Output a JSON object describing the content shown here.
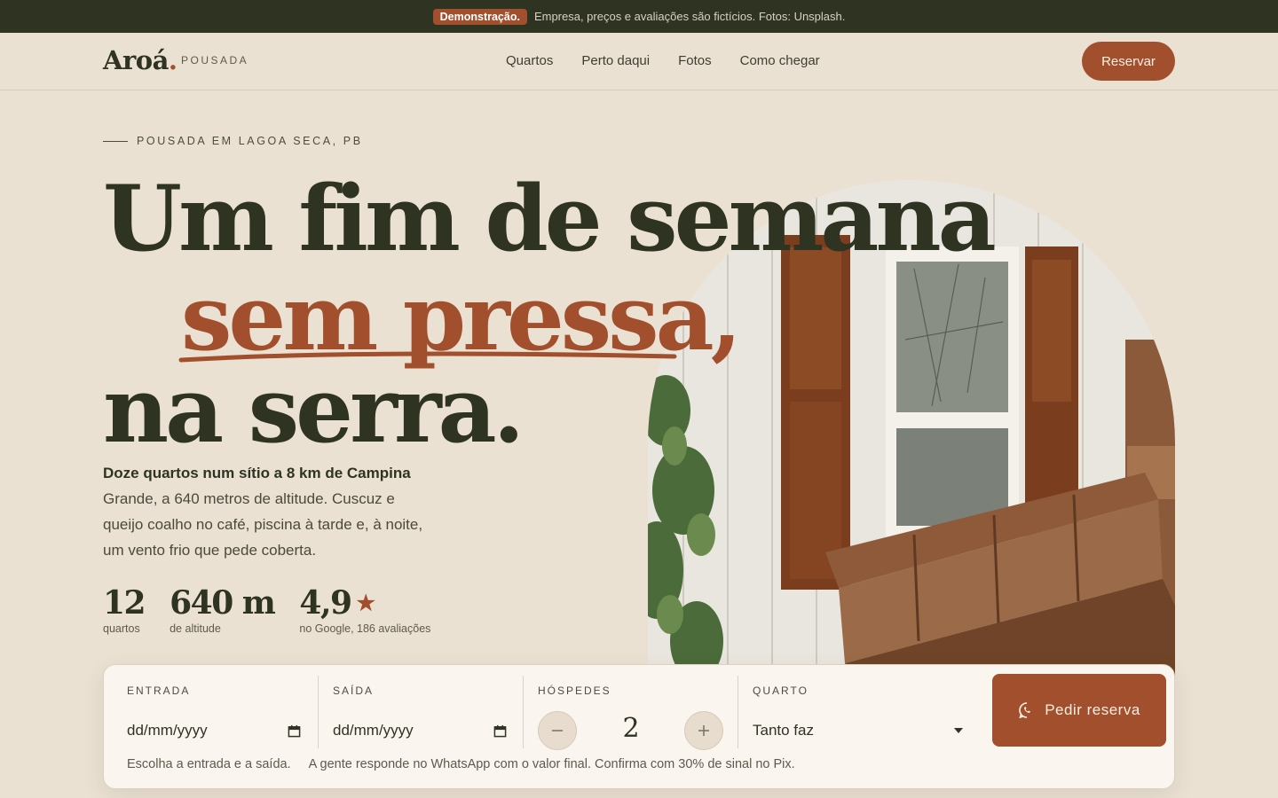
{
  "demo_bar": {
    "badge": "Demonstração.",
    "text": "Empresa, preços e avaliações são fictícios. Fotos: Unsplash."
  },
  "nav": {
    "logo": "Aroá",
    "logo_dot": ".",
    "logo_sub": "POUSADA",
    "links": [
      "Quartos",
      "Perto daqui",
      "Fotos",
      "Como chegar"
    ],
    "cta": "Reservar"
  },
  "hero": {
    "eyebrow": "POUSADA EM LAGOA SECA, PB",
    "headline": [
      "Um fim de semana",
      "sem pressa,",
      "na serra."
    ],
    "lead": "Doze quartos num sítio a 8 km de Campina",
    "body": " Grande, a 640 metros de altitude. Cuscuz e queijo coalho no café, piscina à tarde e, à noite, um vento frio que pede coberta.",
    "stats": [
      {
        "value": "12",
        "label": "quartos"
      },
      {
        "value": "640 m",
        "label": "de altitude"
      },
      {
        "value": "4,9",
        "label": "no Google, 186 avaliações",
        "icon": "star-icon"
      }
    ]
  },
  "booking": {
    "entrada_label": "ENTRADA",
    "entrada_value": "dd/mm/yyyy",
    "saida_label": "SAÍDA",
    "saida_value": "dd/mm/yyyy",
    "hospedes_label": "HÓSPEDES",
    "hospedes_value": "2",
    "quarto_label": "QUARTO",
    "quarto_value": "Tanto faz",
    "submit": "Pedir reserva",
    "note_left": "Escolha a entrada e a saída.",
    "note_right": "A gente responde no WhatsApp com o valor final. Confirma com 30% de sinal no Pix."
  },
  "colors": {
    "background": "#ebe1d3",
    "dark": "#2e3322",
    "accent": "#a24f2d",
    "card": "#faf6ef"
  }
}
